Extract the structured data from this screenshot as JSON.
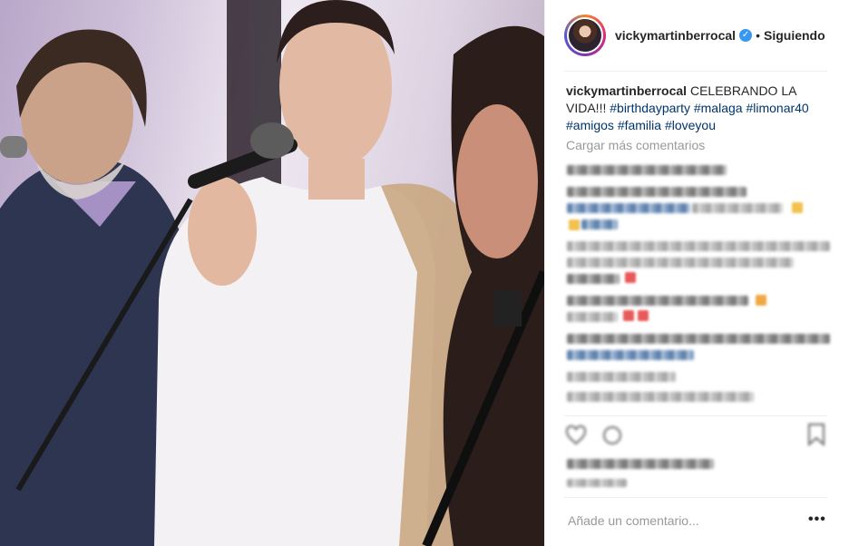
{
  "post": {
    "username": "vickymartinberrocal",
    "verified_icon": "verified-badge-icon",
    "separator": "•",
    "follow_status": "Siguiendo",
    "caption": {
      "author": "vickymartinberrocal",
      "text": "CELEBRANDO LA VIDA!!!",
      "hashtags": [
        "#birthdayparty",
        "#malaga",
        "#limonar40",
        "#amigos",
        "#familia",
        "#loveyou"
      ]
    },
    "load_more_label": "Cargar más comentarios",
    "add_comment_placeholder": "Añade un comentario...",
    "more_options_label": "•••"
  },
  "icons": {
    "heart": "heart-icon",
    "comment": "comment-icon",
    "save": "bookmark-icon",
    "options": "ellipsis-icon"
  },
  "colors": {
    "hashtag": "#003569",
    "verified": "#3897f0",
    "muted": "#999999"
  }
}
